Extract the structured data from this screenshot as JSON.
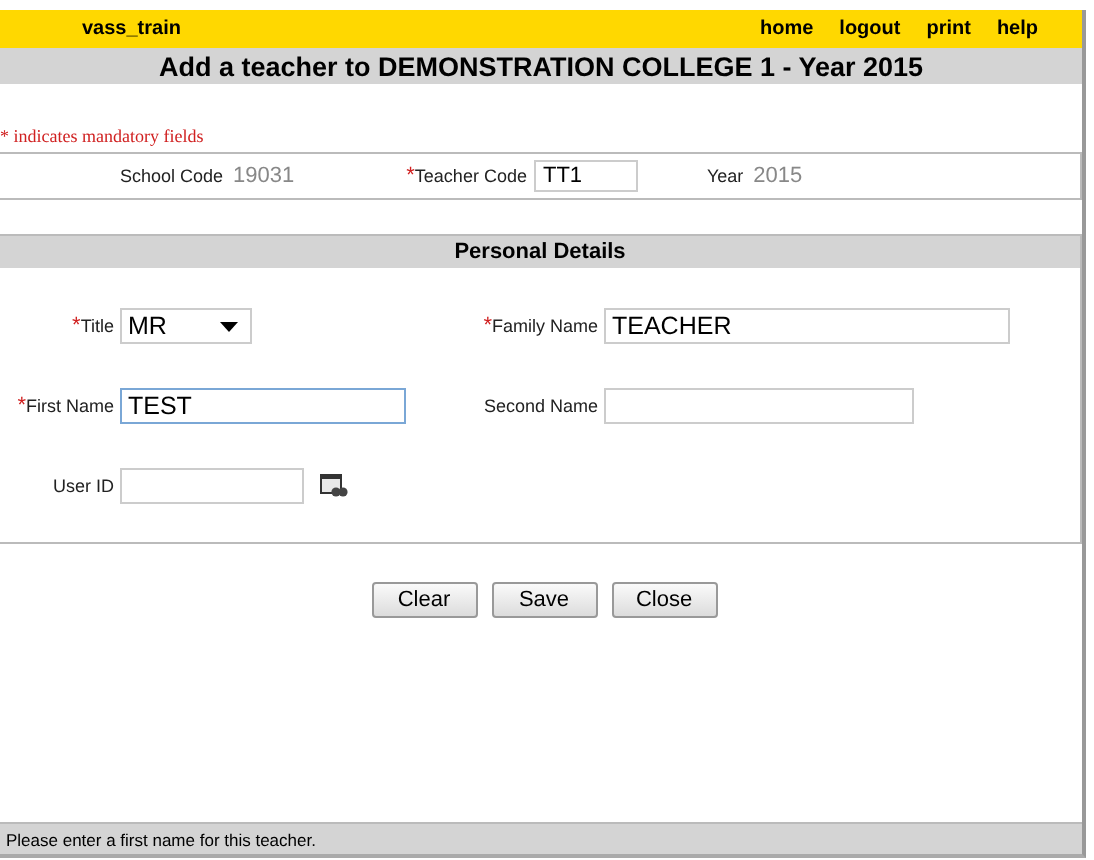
{
  "header": {
    "user": "vass_train",
    "links": [
      "home",
      "logout",
      "print",
      "help"
    ]
  },
  "title": "Add a teacher to DEMONSTRATION COLLEGE 1 - Year 2015",
  "mandatory_note": "* indicates mandatory fields",
  "school_row": [
    {
      "label": "School Code",
      "kind": "value",
      "value": "19031"
    },
    {
      "label": "Teacher Code",
      "mark": "*",
      "kind": "text",
      "value": "TT1"
    },
    {
      "label": "Year",
      "kind": "value",
      "value": "2015"
    }
  ],
  "personal_details": {
    "heading": "Personal Details",
    "fields": [
      {
        "label": "Title",
        "mark": "*",
        "kind": "select",
        "value": "MR",
        "focused": false
      },
      {
        "label": "Family Name",
        "mark": "*",
        "kind": "text",
        "value": "TEACHER",
        "focused": false
      },
      {
        "label": "First Name",
        "mark": "*",
        "kind": "text",
        "value": "TEST",
        "focused": true
      },
      {
        "label": "Second Name",
        "kind": "text",
        "focused": false
      },
      {
        "label": "User ID",
        "kind": "lookup",
        "focused": false
      }
    ]
  },
  "buttons": [
    "Clear",
    "Save",
    "Close"
  ],
  "status_bar": "Please enter a first name for this teacher."
}
